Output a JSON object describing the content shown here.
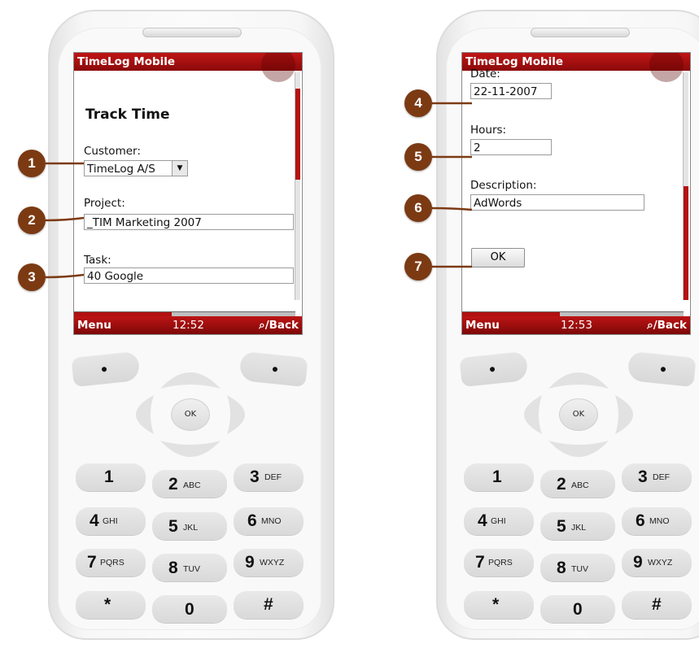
{
  "colors": {
    "accent": "#b51212",
    "badge": "#7c3a13"
  },
  "left_phone": {
    "app_title": "TimeLog Mobile",
    "heading": "Track Time",
    "customer_label": "Customer:",
    "customer_value": "TimeLog A/S",
    "project_label": "Project:",
    "project_value": "_TIM Marketing 2007",
    "task_label": "Task:",
    "task_value": "40 Google",
    "softkey_left": "Menu",
    "time": "12:52",
    "softkey_right": "/Back"
  },
  "right_phone": {
    "app_title": "TimeLog Mobile",
    "date_label": "Date:",
    "date_value": "22-11-2007",
    "hours_label": "Hours:",
    "hours_value": "2",
    "description_label": "Description:",
    "description_value": "AdWords",
    "ok_button": "OK",
    "softkey_left": "Menu",
    "time": "12:53",
    "softkey_right": "/Back"
  },
  "keypad": {
    "ok": "OK",
    "keys": [
      {
        "num": "1",
        "sub": ""
      },
      {
        "num": "2",
        "sub": "ABC"
      },
      {
        "num": "3",
        "sub": "DEF"
      },
      {
        "num": "4",
        "sub": "GHI"
      },
      {
        "num": "5",
        "sub": "JKL"
      },
      {
        "num": "6",
        "sub": "MNO"
      },
      {
        "num": "7",
        "sub": "PQRS"
      },
      {
        "num": "8",
        "sub": "TUV"
      },
      {
        "num": "9",
        "sub": "WXYZ"
      },
      {
        "num": "*",
        "sub": ""
      },
      {
        "num": "0",
        "sub": ""
      },
      {
        "num": "#",
        "sub": ""
      }
    ]
  },
  "callouts": [
    "1",
    "2",
    "3",
    "4",
    "5",
    "6",
    "7"
  ],
  "icons": {
    "search_back": "search-icon",
    "select_arrow": "chevron-down-icon"
  }
}
